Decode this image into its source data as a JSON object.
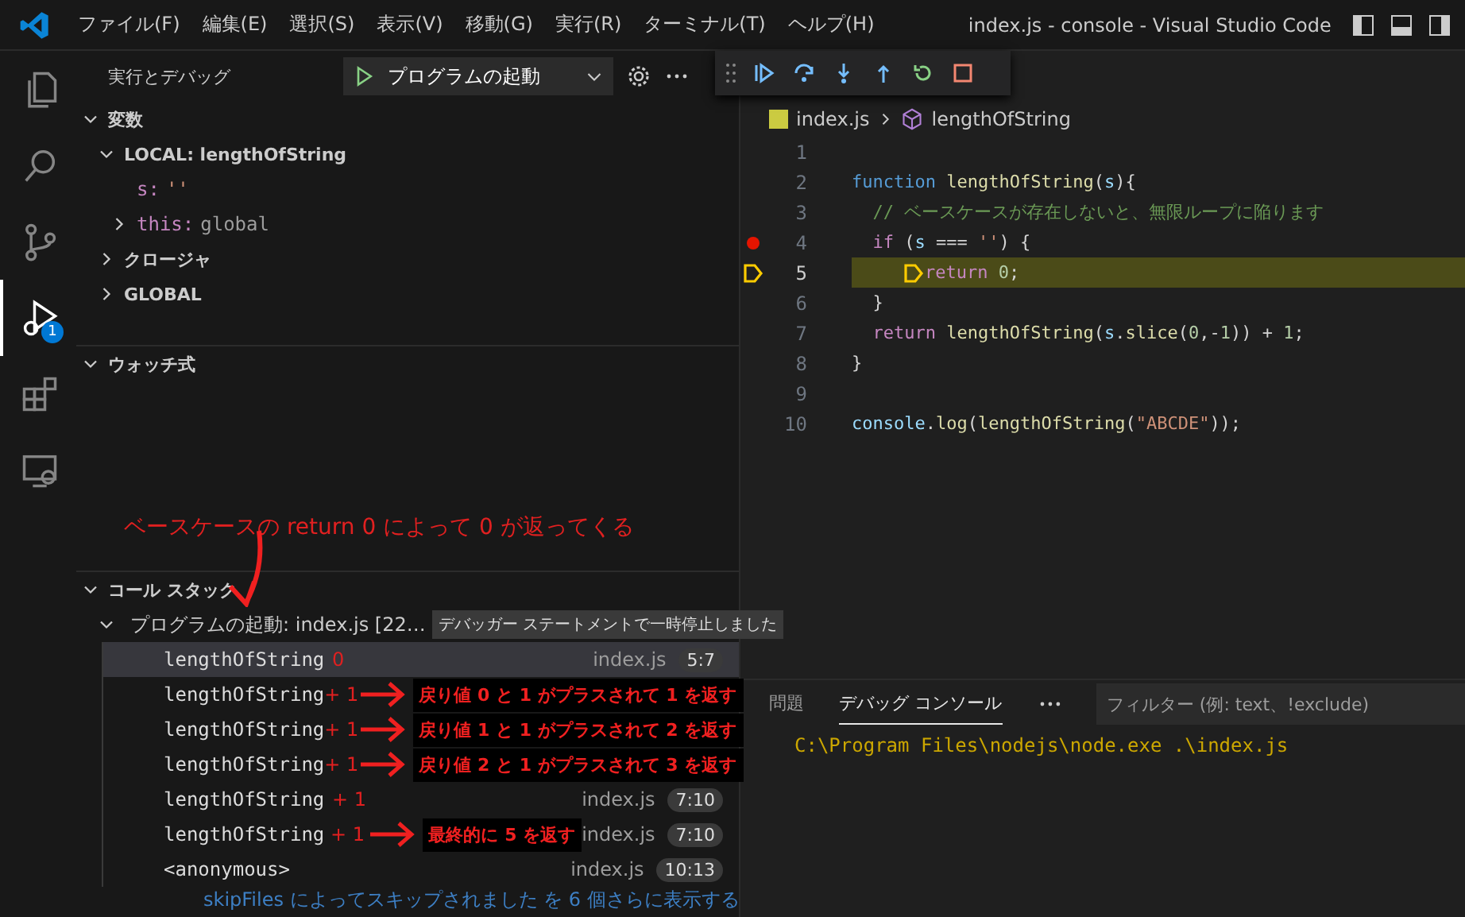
{
  "window": {
    "title": "index.js - console - Visual Studio Code"
  },
  "menu": [
    "ファイル(F)",
    "編集(E)",
    "選択(S)",
    "表示(V)",
    "移動(G)",
    "実行(R)",
    "ターミナル(T)",
    "ヘルプ(H)"
  ],
  "activity_bar": [
    {
      "selected": false
    },
    {
      "selected": false
    },
    {
      "selected": false
    },
    {
      "selected": true,
      "badge": "1"
    },
    {
      "selected": false
    },
    {
      "selected": false
    }
  ],
  "sidebar": {
    "title": "実行とデバッグ",
    "launch_config": "プログラムの起動",
    "variables": {
      "title": "変数",
      "expanded": true,
      "scopes": [
        {
          "label": "LOCAL: lengthOfString",
          "expanded": true,
          "children": [
            {
              "name": "s:",
              "value": "''",
              "kind": "string"
            },
            {
              "name": "this:",
              "value": "global",
              "kind": "object",
              "expanded": false
            }
          ]
        },
        {
          "label": "クロージャ",
          "expanded": false
        },
        {
          "label": "GLOBAL",
          "expanded": false
        }
      ]
    },
    "watch": {
      "title": "ウォッチ式",
      "expanded": true
    },
    "annotation": "ベースケースの return 0 によって 0 が返ってくる",
    "call_stack": {
      "title": "コール スタック",
      "expanded": true,
      "session": "プログラムの起動: index.js [22…",
      "status": "デバッガー ステートメントで一時停止しました",
      "frames": [
        {
          "name": "lengthOfString",
          "mark": "0",
          "selected": true,
          "file": "index.js",
          "position": "5:7"
        },
        {
          "name": "lengthOfString",
          "mark": "+ 1",
          "note": "戻り値 0 と 1 がプラスされて 1 を返す",
          "selected": false
        },
        {
          "name": "lengthOfString",
          "mark": "+ 1",
          "note": "戻り値 1 と 1 がプラスされて 2 を返す",
          "selected": false
        },
        {
          "name": "lengthOfString",
          "mark": "+ 1",
          "note": "戻り値 2 と 1 がプラスされて 3 を返す",
          "selected": false
        },
        {
          "name": "lengthOfString",
          "mark": "+ 1",
          "selected": false,
          "file": "index.js",
          "position": "7:10"
        },
        {
          "name": "lengthOfString",
          "mark": "+ 1",
          "note": "最終的に 5 を返す",
          "selected": false,
          "file": "index.js",
          "position": "7:10"
        },
        {
          "name": "<anonymous>",
          "selected": false,
          "file": "index.js",
          "position": "10:13"
        }
      ],
      "show_more": "skipFiles によってスキップされました を 6 個さらに表示する"
    }
  },
  "editor": {
    "breadcrumb": [
      "index.js",
      "lengthOfString"
    ],
    "lines": [
      {
        "number": "1",
        "breakpoint": false,
        "current": false
      },
      {
        "number": "2",
        "breakpoint": false,
        "current": false,
        "tokens": [
          {
            "text": "function ",
            "kind": "kw"
          },
          {
            "text": "lengthOfString",
            "kind": "fn"
          },
          {
            "text": "(",
            "kind": "plain"
          },
          {
            "text": "s",
            "kind": "var"
          },
          {
            "text": "){",
            "kind": "plain"
          }
        ]
      },
      {
        "number": "3",
        "breakpoint": false,
        "current": false,
        "tokens": [
          {
            "text": "  // ベースケースが存在しないと、無限ループに陥ります",
            "kind": "comment"
          }
        ]
      },
      {
        "number": "4",
        "breakpoint": true,
        "current": false,
        "tokens": [
          {
            "text": "  if",
            "kind": "ctrl"
          },
          {
            "text": " (",
            "kind": "plain"
          },
          {
            "text": "s",
            "kind": "var"
          },
          {
            "text": " === ",
            "kind": "plain"
          },
          {
            "text": "''",
            "kind": "str"
          },
          {
            "text": ") {",
            "kind": "plain"
          }
        ]
      },
      {
        "number": "5",
        "breakpoint": false,
        "current": true,
        "tokens": [
          {
            "text": "return ",
            "kind": "ctrl"
          },
          {
            "text": "0",
            "kind": "num"
          },
          {
            "text": ";",
            "kind": "plain"
          }
        ]
      },
      {
        "number": "6",
        "breakpoint": false,
        "current": false,
        "tokens": [
          {
            "text": "  }",
            "kind": "plain"
          }
        ]
      },
      {
        "number": "7",
        "breakpoint": false,
        "current": false,
        "tokens": [
          {
            "text": "  return ",
            "kind": "ctrl"
          },
          {
            "text": "lengthOfString",
            "kind": "fn"
          },
          {
            "text": "(",
            "kind": "plain"
          },
          {
            "text": "s",
            "kind": "var"
          },
          {
            "text": ".",
            "kind": "plain"
          },
          {
            "text": "slice",
            "kind": "fn"
          },
          {
            "text": "(",
            "kind": "plain"
          },
          {
            "text": "0",
            "kind": "num"
          },
          {
            "text": ",-",
            "kind": "plain"
          },
          {
            "text": "1",
            "kind": "num"
          },
          {
            "text": ")) + ",
            "kind": "plain"
          },
          {
            "text": "1",
            "kind": "num"
          },
          {
            "text": ";",
            "kind": "plain"
          }
        ]
      },
      {
        "number": "8",
        "breakpoint": false,
        "current": false,
        "tokens": [
          {
            "text": "}",
            "kind": "plain"
          }
        ]
      },
      {
        "number": "9",
        "breakpoint": false,
        "current": false
      },
      {
        "number": "10",
        "breakpoint": false,
        "current": false,
        "tokens": [
          {
            "text": "console",
            "kind": "var"
          },
          {
            "text": ".",
            "kind": "plain"
          },
          {
            "text": "log",
            "kind": "fn"
          },
          {
            "text": "(",
            "kind": "plain"
          },
          {
            "text": "lengthOfString",
            "kind": "fn"
          },
          {
            "text": "(",
            "kind": "plain"
          },
          {
            "text": "\"ABCDE\"",
            "kind": "str"
          },
          {
            "text": "));",
            "kind": "plain"
          }
        ]
      }
    ]
  },
  "panel": {
    "tabs": [
      {
        "label": "問題",
        "selected": false
      },
      {
        "label": "デバッグ コンソール",
        "selected": true
      }
    ],
    "filter_placeholder": "フィルター (例: text、!exclude)",
    "console": [
      "C:\\Program Files\\nodejs\\node.exe .\\index.js"
    ]
  }
}
